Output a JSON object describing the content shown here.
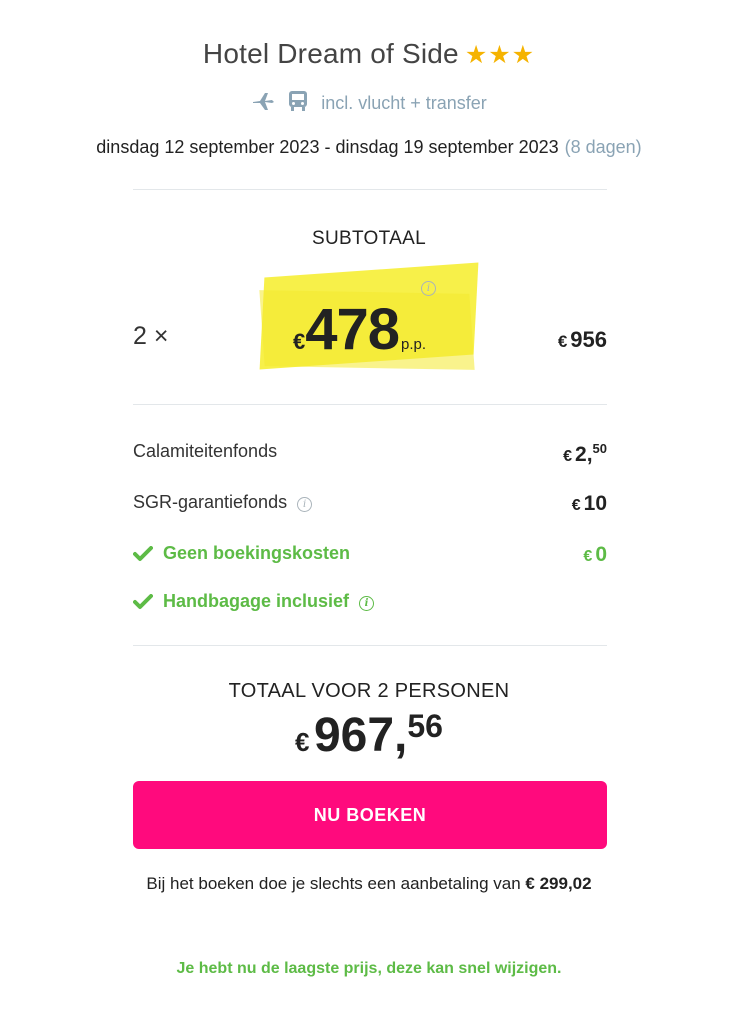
{
  "hotel": {
    "name": "Hotel Dream of Side",
    "stars": "★★★"
  },
  "package": {
    "includes": "incl. vlucht + transfer",
    "plane_icon": "plane-icon",
    "bus_icon": "bus-icon"
  },
  "period": {
    "range": "dinsdag 12 september 2023 - dinsdag 19 september 2023",
    "duration": "(8 dagen)"
  },
  "subtotal": {
    "label": "SUBTOTAAL",
    "quantity": "2 ×",
    "currency": "€",
    "price_per_person": "478",
    "per_person_label": "p.p.",
    "line_total_currency": "€",
    "line_total": "956"
  },
  "fees": [
    {
      "label": "Calamiteitenfonds",
      "currency": "€",
      "amount": "2,",
      "cents": "50"
    },
    {
      "label": "SGR-garantiefonds",
      "currency": "€",
      "amount": "10"
    },
    {
      "label": "Geen boekingskosten",
      "currency": "€",
      "amount": "0"
    },
    {
      "label": "Handbagage inclusief"
    }
  ],
  "total": {
    "label": "TOTAAL VOOR 2 PERSONEN",
    "currency": "€",
    "amount": "967,",
    "cents": "56"
  },
  "book_button": "NU BOEKEN",
  "deposit": {
    "text": "Bij het boeken doe je slechts een aanbetaling van",
    "amount": "€ 299,02"
  },
  "notice": "Je hebt nu de laagste prijs, deze kan snel wijzigen.",
  "colors": {
    "accent": "#ff0a7d",
    "green": "#5dbb46",
    "star": "#f5b301",
    "highlight": "#f7ef3f",
    "muted": "#8aa3b4"
  }
}
